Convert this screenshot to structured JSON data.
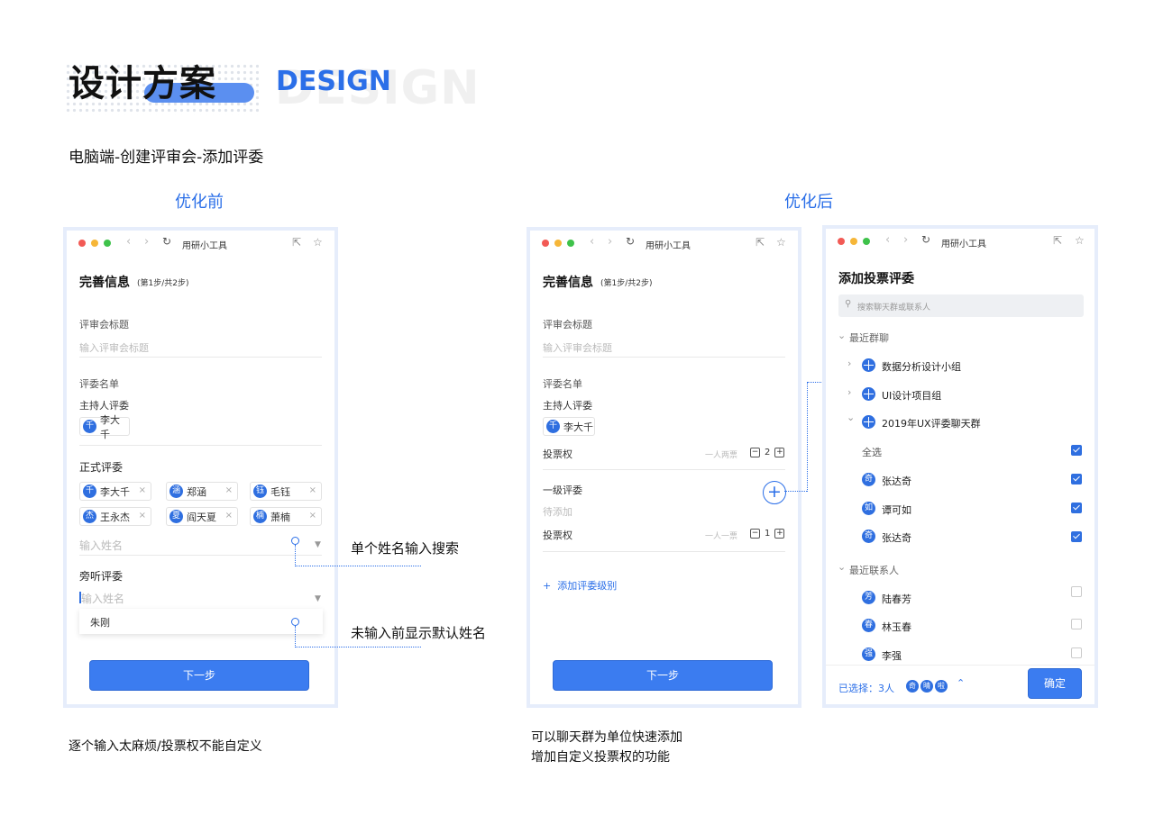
{
  "header": {
    "title": "设计方案",
    "design_word": "DESIGN",
    "design_ghost": "DESIGN",
    "subtitle": "电脑端-创建评审会-添加评委"
  },
  "sections": {
    "before": "优化前",
    "after": "优化后"
  },
  "browser": {
    "title": "用研小工具"
  },
  "before_form": {
    "heading": "完善信息",
    "step": "(第1步/共2步)",
    "title_label": "评审会标题",
    "title_placeholder": "输入评审会标题",
    "list_label": "评委名单",
    "host_label": "主持人评委",
    "host_tag": {
      "avatar": "千",
      "name": "李大千"
    },
    "formal_label": "正式评委",
    "formal_tags": [
      {
        "avatar": "千",
        "name": "李大千"
      },
      {
        "avatar": "涵",
        "name": "郑涵"
      },
      {
        "avatar": "钰",
        "name": "毛钰"
      },
      {
        "avatar": "杰",
        "name": "王永杰"
      },
      {
        "avatar": "夏",
        "name": "阎天夏"
      },
      {
        "avatar": "楠",
        "name": "萧楠"
      }
    ],
    "remove_glyph": "×",
    "formal_input_placeholder": "输入姓名",
    "audit_label": "旁听评委",
    "audit_input_placeholder": "输入姓名",
    "suggestion": "朱刚",
    "next": "下一步"
  },
  "annotations": {
    "search": "单个姓名输入搜索",
    "default_name": "未输入前显示默认姓名"
  },
  "after_form": {
    "heading": "完善信息",
    "step": "(第1步/共2步)",
    "title_label": "评审会标题",
    "title_placeholder": "输入评审会标题",
    "list_label": "评委名单",
    "host_label": "主持人评委",
    "host_tag": {
      "avatar": "千",
      "name": "李大千"
    },
    "vote_label": "投票权",
    "host_vote_hint": "一人两票",
    "host_vote_value": "2",
    "level1_label": "一级评委",
    "level1_pending": "待添加",
    "level1_vote_hint": "一人一票",
    "level1_vote_value": "1",
    "minus": "−",
    "plus": "+",
    "add_level": "添加评委级别",
    "add_plus": "+",
    "next": "下一步"
  },
  "picker": {
    "title": "添加投票评委",
    "search_placeholder": "搜索聊天群或联系人",
    "recent_groups_label": "最近群聊",
    "groups": [
      "数据分析设计小组",
      "UI设计项目组",
      "2019年UX评委聊天群"
    ],
    "select_all": "全选",
    "members": [
      {
        "avatar": "奇",
        "name": "张达奇",
        "checked": true
      },
      {
        "avatar": "如",
        "name": "谭可如",
        "checked": true
      },
      {
        "avatar": "奇",
        "name": "张达奇",
        "checked": true
      }
    ],
    "recent_contacts_label": "最近联系人",
    "contacts": [
      {
        "avatar": "芳",
        "name": "陆春芳",
        "checked": false
      },
      {
        "avatar": "春",
        "name": "林玉春",
        "checked": false
      },
      {
        "avatar": "强",
        "name": "李强",
        "checked": false
      }
    ],
    "selected_label": "已选择：3人",
    "selected_avatars": [
      "奇",
      "晴",
      "啦"
    ],
    "confirm": "确定"
  },
  "notes": {
    "before": "逐个输入太麻烦/投票权不能自定义",
    "after_line1": "可以聊天群为单位快速添加",
    "after_line2": "增加自定义投票权的功能"
  },
  "colors": {
    "accent": "#2b6fe8",
    "button": "#3b7cf0",
    "frame": "#e6edfb"
  }
}
